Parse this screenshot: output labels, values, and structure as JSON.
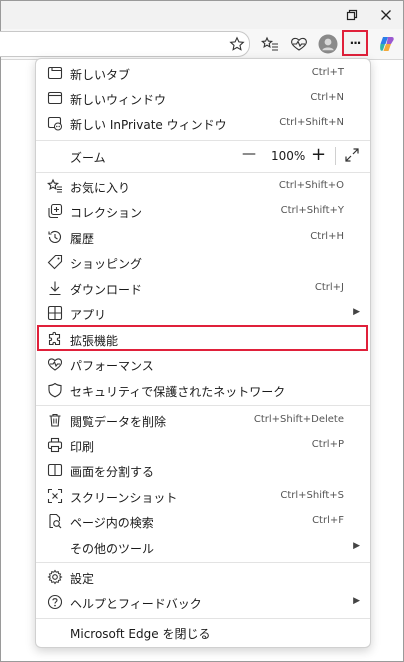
{
  "window": {
    "controls": [
      {
        "name": "restore",
        "glyph": "❐"
      },
      {
        "name": "close",
        "glyph": "✕"
      }
    ]
  },
  "toolbar": {
    "icons": [
      "favorite-star-icon",
      "favorites-list-icon",
      "health-icon",
      "profile-avatar-icon",
      "more-icon",
      "copilot-icon"
    ],
    "more_glyph": "···",
    "highlight_color": "#e0203a"
  },
  "menu": {
    "items": [
      {
        "id": "new-tab",
        "label": "新しいタブ",
        "shortcut": "Ctrl+T",
        "icon": "new-tab-icon"
      },
      {
        "id": "new-window",
        "label": "新しいウィンドウ",
        "shortcut": "Ctrl+N",
        "icon": "new-window-icon"
      },
      {
        "id": "new-inprivate",
        "label": "新しい InPrivate ウィンドウ",
        "shortcut": "Ctrl+Shift+N",
        "icon": "inprivate-icon"
      },
      {
        "id": "favorites",
        "label": "お気に入り",
        "shortcut": "Ctrl+Shift+O",
        "icon": "favorites-icon"
      },
      {
        "id": "collections",
        "label": "コレクション",
        "shortcut": "Ctrl+Shift+Y",
        "icon": "collections-icon"
      },
      {
        "id": "history",
        "label": "履歴",
        "shortcut": "Ctrl+H",
        "icon": "history-icon"
      },
      {
        "id": "shopping",
        "label": "ショッピング",
        "shortcut": "",
        "icon": "shopping-tag-icon"
      },
      {
        "id": "downloads",
        "label": "ダウンロード",
        "shortcut": "Ctrl+J",
        "icon": "download-icon"
      },
      {
        "id": "apps",
        "label": "アプリ",
        "shortcut": "",
        "icon": "apps-icon",
        "submenu": true
      },
      {
        "id": "extensions",
        "label": "拡張機能",
        "shortcut": "",
        "icon": "extensions-puzzle-icon",
        "highlighted": true
      },
      {
        "id": "performance",
        "label": "パフォーマンス",
        "shortcut": "",
        "icon": "performance-icon"
      },
      {
        "id": "security",
        "label": "セキュリティで保護されたネットワーク",
        "shortcut": "",
        "icon": "shield-icon"
      },
      {
        "id": "clear-data",
        "label": "閲覧データを削除",
        "shortcut": "Ctrl+Shift+Delete",
        "icon": "trash-icon"
      },
      {
        "id": "print",
        "label": "印刷",
        "shortcut": "Ctrl+P",
        "icon": "print-icon"
      },
      {
        "id": "split-screen",
        "label": "画面を分割する",
        "shortcut": "",
        "icon": "split-screen-icon"
      },
      {
        "id": "screenshot",
        "label": "スクリーンショット",
        "shortcut": "Ctrl+Shift+S",
        "icon": "screenshot-icon"
      },
      {
        "id": "find",
        "label": "ページ内の検索",
        "shortcut": "Ctrl+F",
        "icon": "find-icon"
      },
      {
        "id": "more-tools",
        "label": "その他のツール",
        "shortcut": "",
        "icon": "",
        "submenu": true
      },
      {
        "id": "settings",
        "label": "設定",
        "shortcut": "",
        "icon": "gear-icon"
      },
      {
        "id": "help",
        "label": "ヘルプとフィードバック",
        "shortcut": "",
        "icon": "help-icon",
        "submenu": true
      },
      {
        "id": "close-edge",
        "label": "Microsoft Edge を閉じる",
        "shortcut": "",
        "icon": ""
      }
    ],
    "zoom": {
      "label": "ズーム",
      "minus": "—",
      "value": "100%",
      "plus": "+",
      "fullscreen_icon": "fullscreen-icon"
    },
    "submenu_arrow": "▶"
  }
}
